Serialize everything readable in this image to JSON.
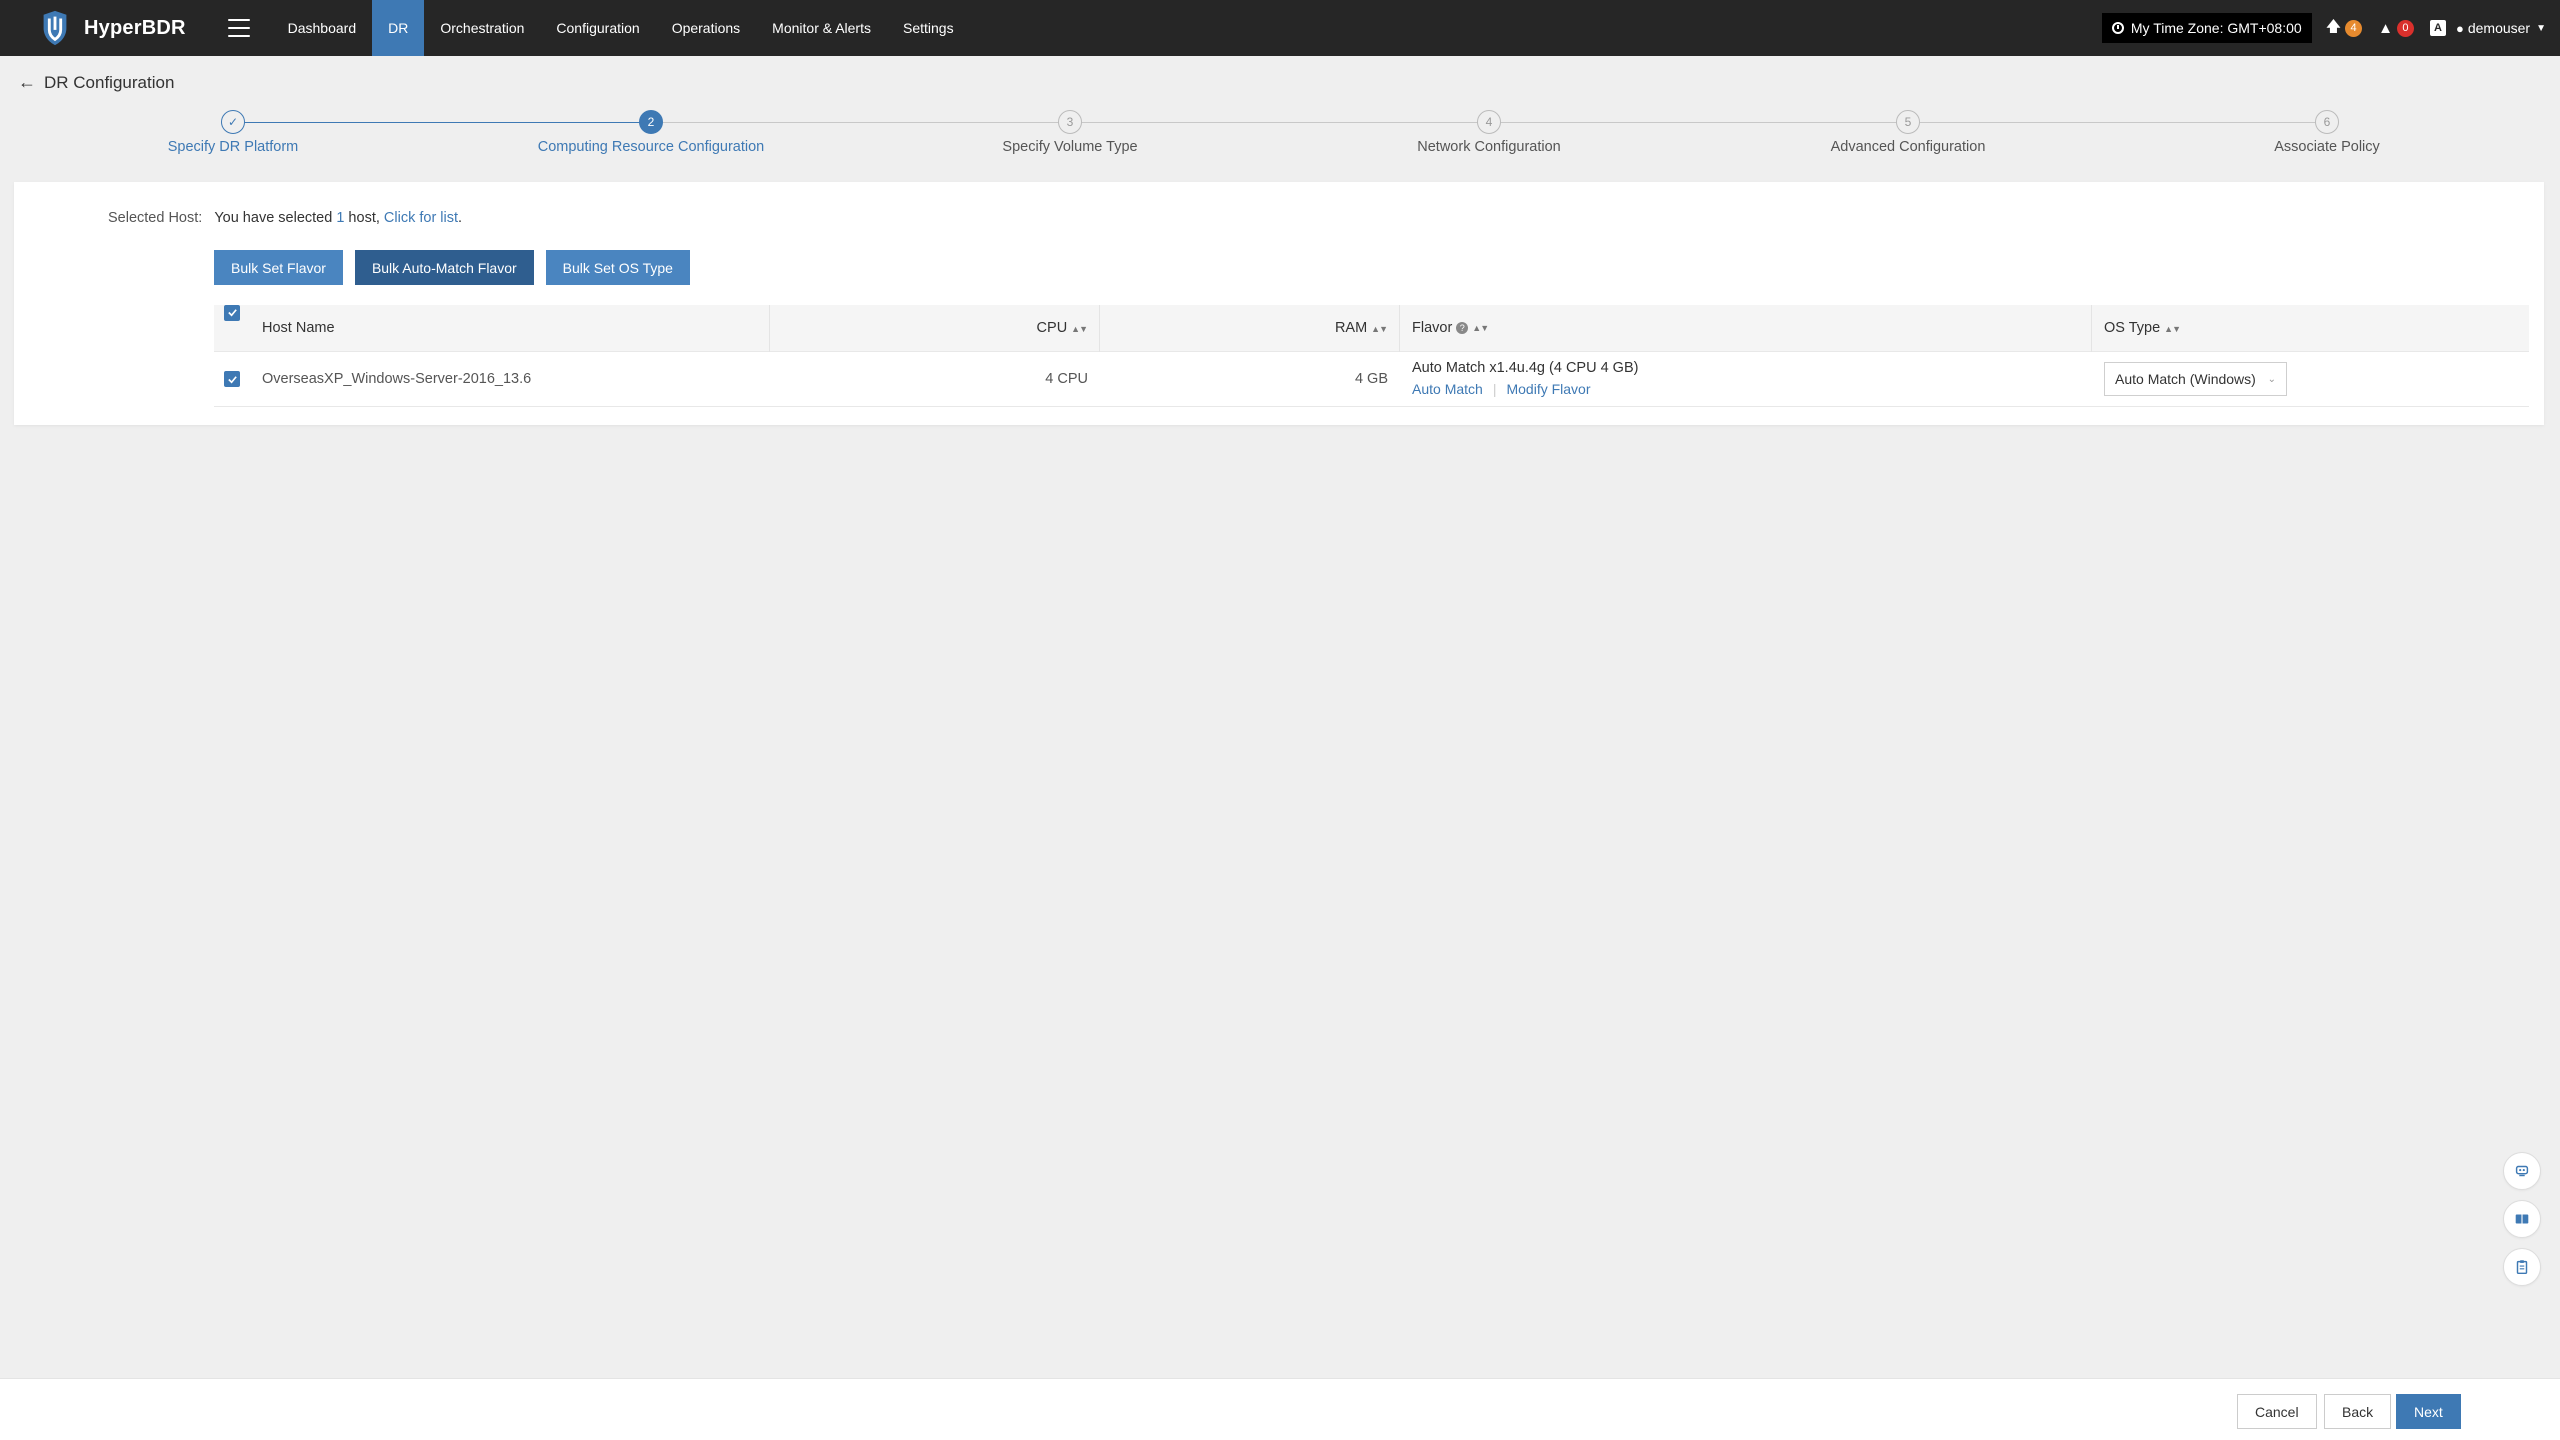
{
  "app": {
    "name": "HyperBDR"
  },
  "nav": {
    "items": [
      {
        "label": "Dashboard",
        "active": false
      },
      {
        "label": "DR",
        "active": true
      },
      {
        "label": "Orchestration",
        "active": false
      },
      {
        "label": "Configuration",
        "active": false
      },
      {
        "label": "Operations",
        "active": false
      },
      {
        "label": "Monitor & Alerts",
        "active": false
      },
      {
        "label": "Settings",
        "active": false
      }
    ]
  },
  "header_right": {
    "timezone": "My Time Zone: GMT+08:00",
    "upload_count": "4",
    "alert_count": "0",
    "language_icon": "A",
    "user": "demouser"
  },
  "page": {
    "title": "DR Configuration"
  },
  "steps": [
    {
      "number": "✓",
      "label": "Specify DR Platform",
      "state": "done"
    },
    {
      "number": "2",
      "label": "Computing Resource Configuration",
      "state": "current"
    },
    {
      "number": "3",
      "label": "Specify Volume Type",
      "state": "pending"
    },
    {
      "number": "4",
      "label": "Network Configuration",
      "state": "pending"
    },
    {
      "number": "5",
      "label": "Advanced Configuration",
      "state": "pending"
    },
    {
      "number": "6",
      "label": "Associate Policy",
      "state": "pending"
    }
  ],
  "selection": {
    "label": "Selected Host:",
    "text_before": "You have selected ",
    "count": "1",
    "text_after": " host, ",
    "link": "Click for list",
    "end": "."
  },
  "bulk_buttons": {
    "set_flavor": "Bulk Set Flavor",
    "auto_match_flavor": "Bulk Auto-Match Flavor",
    "set_os_type": "Bulk Set OS Type"
  },
  "table": {
    "columns": {
      "host_name": "Host Name",
      "cpu": "CPU",
      "ram": "RAM",
      "flavor": "Flavor",
      "os_type": "OS Type"
    },
    "rows": [
      {
        "host_name": "OverseasXP_Windows-Server-2016_13.6",
        "cpu": "4 CPU",
        "ram": "4 GB",
        "flavor": "Auto Match x1.4u.4g (4 CPU 4 GB)",
        "flavor_action_auto": "Auto Match",
        "flavor_action_modify": "Modify Flavor",
        "os_type": "Auto Match (Windows)"
      }
    ]
  },
  "footer": {
    "cancel": "Cancel",
    "back": "Back",
    "next": "Next"
  },
  "colors": {
    "primary": "#3e79b4",
    "topbar": "#262626",
    "upload_badge": "#e68a2e",
    "alert_badge": "#d9302c"
  }
}
